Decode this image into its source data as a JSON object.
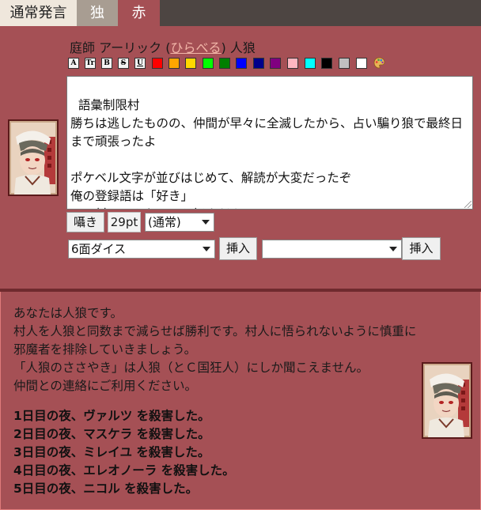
{
  "tabs": [
    {
      "label": "通常発言"
    },
    {
      "label": "独"
    },
    {
      "label": "赤"
    }
  ],
  "speaker": {
    "prefix": "庭師 アーリック (",
    "link": "ひらべる",
    "suffix": ") 人狼"
  },
  "toolbar": {
    "format_buttons": [
      "A",
      "Tr",
      "B",
      "S",
      "U"
    ],
    "colors": [
      "#ff0000",
      "#ffa500",
      "#ffd700",
      "#00ff00",
      "#008000",
      "#0000ff",
      "#00008b",
      "#800080",
      "#ffb6c1",
      "#00ffff",
      "#000000",
      "#c0c0c0",
      "#ffffff"
    ],
    "palette_icon": "palette-icon"
  },
  "message": {
    "value": "語彙制限村\n勝ちは逃したものの、仲間が早々に全滅したから、占い騙り狼で最終日まで頑張ったよ\n\nポケベル文字が並びはじめて、解読が大変だったぞ\n俺の登録語は「好き」\nこの村のみんなのこと好きだよ"
  },
  "controls": {
    "whisper_label": "囁き",
    "font_size": "29pt",
    "volume_selected": "(通常)",
    "dice_selected": "6面ダイス",
    "insert_label": "挿入",
    "insert2_label": "挿入",
    "extra_selected": ""
  },
  "role": {
    "lines": [
      "あなたは人狼です。",
      "村人を人狼と同数まで減らせば勝利です。村人に悟られないように慎重に邪魔者を排除していきましょう。",
      "「人狼のささやき」は人狼（とＣ国狂人）にしか聞こえません。",
      "仲間との連絡にご利用ください。"
    ],
    "kills": [
      "1日目の夜、ヴァルツ を殺害した。",
      "2日目の夜、マスケラ を殺害した。",
      "3日目の夜、ミレイユ を殺害した。",
      "4日目の夜、エレオノーラ を殺害した。",
      "5日目の夜、ニコル を殺害した。"
    ]
  }
}
